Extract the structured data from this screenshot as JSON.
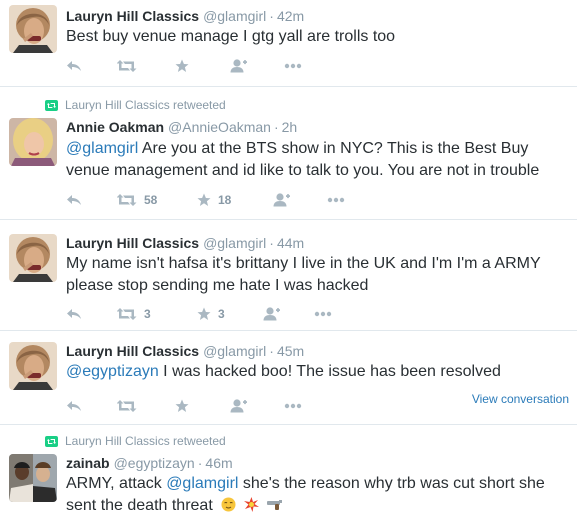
{
  "tweets": [
    {
      "fullname": "Lauryn Hill Classics",
      "username": "@glamgirl",
      "time": "42m",
      "text": "Best buy venue manage I gtg yall are trolls too"
    },
    {
      "retweet_context": "Lauryn Hill Classics retweeted",
      "fullname": "Annie Oakman",
      "username": "@AnnieOakman",
      "time": "2h",
      "mention": "@glamgirl",
      "text_line1": " Are you at the BTS show in NYC? This is the Best Buy",
      "text_line2": "venue management and id like to talk to you. You are not in trouble",
      "retweet_count": "58",
      "favorite_count": "18"
    },
    {
      "fullname": "Lauryn Hill Classics",
      "username": "@glamgirl",
      "time": "44m",
      "text_line1": "My name isn't hafsa it's brittany I live in the UK and I'm I'm a ARMY",
      "text_line2": "please stop sending me hate I was hacked",
      "retweet_count": "3",
      "favorite_count": "3"
    },
    {
      "fullname": "Lauryn Hill Classics",
      "username": "@glamgirl",
      "time": "45m",
      "mention": "@egyptizayn",
      "text": " I was hacked boo! The issue has been resolved",
      "view_conversation": "View conversation"
    },
    {
      "retweet_context": "Lauryn Hill Classics retweeted",
      "fullname": "zainab",
      "username": "@egyptizayn",
      "time": "46m",
      "text_before": "ARMY, attack ",
      "mention": "@glamgirl",
      "text_after": " she's the reason why trb was cut short she",
      "text_line2": "sent the death threat",
      "emojis": [
        "relieved-face-emoji",
        "collision-emoji",
        "pistol-emoji"
      ]
    }
  ],
  "colors": {
    "link": "#2b7bb9",
    "muted": "#8899a6",
    "icon": "#aab8c2",
    "retweet_green": "#19cf86",
    "divider": "#e1e8ed"
  }
}
